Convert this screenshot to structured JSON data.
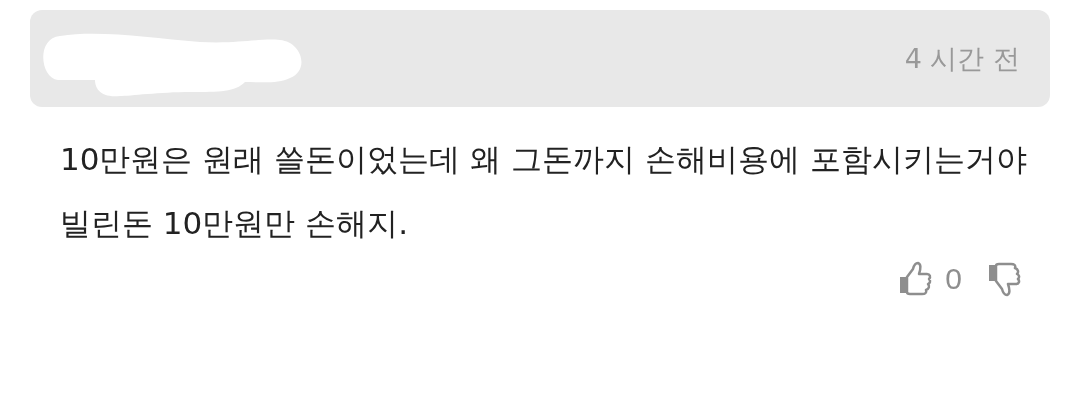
{
  "comment": {
    "time": "4 시간 전",
    "paragraphs": [
      "10만원은 원래 쓸돈이었는데 왜 그돈까지 손해비용에 포함시키는거야",
      "빌린돈 10만원만 손해지."
    ],
    "like_count": "0"
  }
}
